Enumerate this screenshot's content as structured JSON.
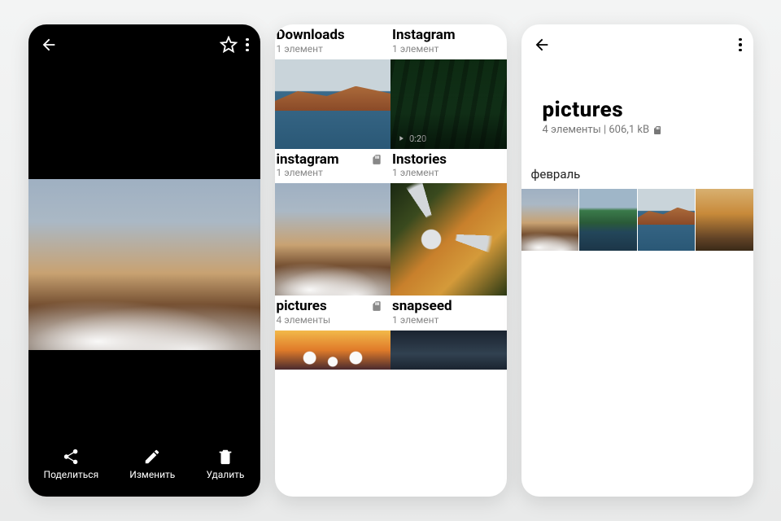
{
  "viewer": {
    "actions": {
      "share": "Поделиться",
      "edit": "Изменить",
      "delete": "Удалить"
    }
  },
  "albums": [
    {
      "name": "Downloads",
      "sub": "1 элемент",
      "sd": false,
      "art": "th-lake"
    },
    {
      "name": "Instagram",
      "sub": "1 элемент",
      "sd": false,
      "art": "th-green",
      "video": "0:20"
    },
    {
      "name": "instagram",
      "sub": "1 элемент",
      "sd": true,
      "art": "landscape1"
    },
    {
      "name": "Instories",
      "sub": "1 элемент",
      "sd": false,
      "art": "th-road"
    },
    {
      "name": "pictures",
      "sub": "4 элементы",
      "sd": true,
      "art": "th-flowers"
    },
    {
      "name": "snapseed",
      "sub": "1 элемент",
      "sd": false,
      "art": "th-dark"
    }
  ],
  "detail": {
    "title": "pictures",
    "sub": "4 элементы | 606,1 kB",
    "month": "февраль"
  }
}
